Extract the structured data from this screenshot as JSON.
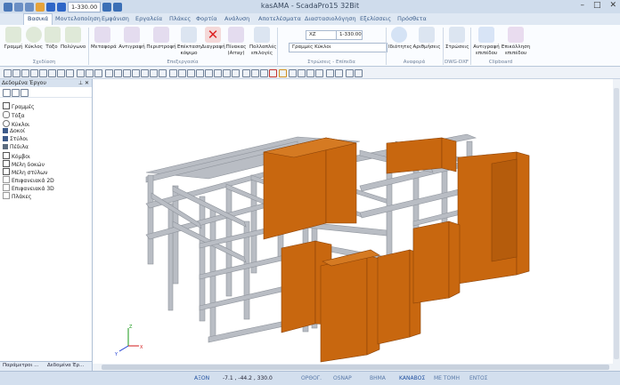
{
  "window": {
    "title": "kasAMA - ScadaPro15 32Bit",
    "controls": [
      "–",
      "□",
      "✕"
    ]
  },
  "quick_access": {
    "level_value": "1-330.00"
  },
  "tabs": [
    "Βασικά",
    "Μοντελοποίηση",
    "Εμφάνιση",
    "Εργαλεία",
    "Πλάκες",
    "Φορτία",
    "Ανάλυση",
    "Αποτελέσματα",
    "Διαστασιολόγηση",
    "Εξελίσσεις",
    "Πρόσθετα"
  ],
  "ribbon": {
    "buttons": {
      "line": "Γραμμή",
      "circle": "Κύκλος",
      "arc": "Τόξο",
      "polygon": "Πολύγωνο",
      "move": "Μεταφορά",
      "copy": "Αντιγραφή",
      "rotate": "Περιστροφή",
      "extend": "Επέκταση κόψιμο",
      "delete": "Διαγραφή",
      "array": "Πίνακας (Array)",
      "multiple": "Πολλαπλές επιλογές",
      "properties": "Ιδιότητες",
      "numbering": "Αριθμήσεις",
      "layers": "Στρώσεις",
      "copy_clip": "Αντιγραφή επιπέδου",
      "paste_clip": "Επικόλληση επιπέδου"
    },
    "groups": {
      "draw": "Σχεδίαση",
      "edit": "Επεξεργασία",
      "layers": "Στρώσεις - Επίπεδα",
      "reference": "Αναφορά",
      "dwg": "DWG-DXF",
      "clipboard": "Clipboard"
    },
    "combos": {
      "plane": "XZ",
      "level": "1-330.00",
      "layer": "Γραμμές Κύκλοι"
    }
  },
  "project_panel": {
    "title": "Δεδομένα Έργου",
    "pin": "⊥",
    "close": "✕",
    "items": [
      "Γραμμές",
      "Τόξα",
      "Κύκλοι",
      "Δοκοί",
      "Στύλοι",
      "Πέδιλα",
      "Κόμβοι",
      "Μέλη δοκών",
      "Μέλη στύλων",
      "Επιφανειακά 2D",
      "Επιφανειακά 3D",
      "Πλάκες"
    ],
    "tabs": [
      "Παράμετροι ...",
      "Δεδομένα Έρ..."
    ]
  },
  "axes": {
    "x": "X",
    "y": "Y",
    "z": "Z"
  },
  "statusbar": {
    "items": [
      "ΑΞΟΝ",
      "-7.1 , -44.2 , 330.0",
      "ΟΡΘΟΓ.",
      "OSNAP",
      "ΒΗΜΑ",
      "ΚΑΝΑΒΟΣ",
      "ΜΕ ΤΟΜΗ",
      "ΕΝΤΟΣ"
    ]
  },
  "colors": {
    "wall": "#c8670f",
    "frame": "#b7bbc2",
    "accent": "#1f4f9f"
  }
}
